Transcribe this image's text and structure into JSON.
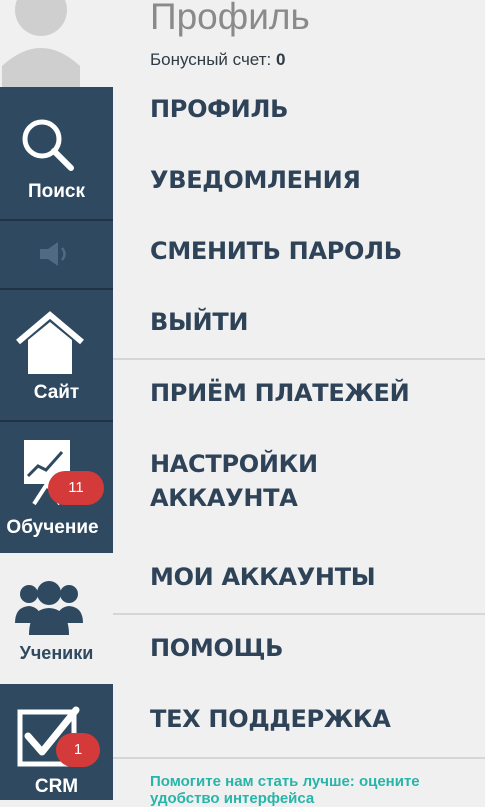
{
  "header": {
    "title": "Профиль",
    "bonus_label": "Бонусный счет:",
    "bonus_value": "0"
  },
  "rail": {
    "search": {
      "label": "Поиск",
      "icon": "search-icon"
    },
    "sound": {
      "icon": "speaker-icon"
    },
    "site": {
      "label": "Сайт",
      "icon": "home-icon"
    },
    "learning": {
      "label": "Обучение",
      "icon": "presentation-chart-icon",
      "badge": "11"
    },
    "students": {
      "label": "Ученики",
      "icon": "users-icon"
    },
    "crm": {
      "label": "CRM",
      "icon": "checkbox-icon",
      "badge": "1"
    }
  },
  "menu": {
    "items": [
      "ПРОФИЛЬ",
      "УВЕДОМЛЕНИЯ",
      "СМЕНИТЬ ПАРОЛЬ",
      "ВЫЙТИ",
      "ПРИЁМ ПЛАТЕЖЕЙ",
      "НАСТРОЙКИ",
      "АККАУНТА",
      "МОИ АККАУНТЫ",
      "ПОМОЩЬ",
      "ТЕХ ПОДДЕРЖКА"
    ]
  },
  "feedback": {
    "line1": "Помогите нам стать лучше: оцените",
    "line2": "удобство интерфейса"
  },
  "colors": {
    "rail_dark": "#2f4a60",
    "menu_text": "#2f4358",
    "badge": "#d43a3a",
    "feedback_link": "#27b5a9"
  }
}
